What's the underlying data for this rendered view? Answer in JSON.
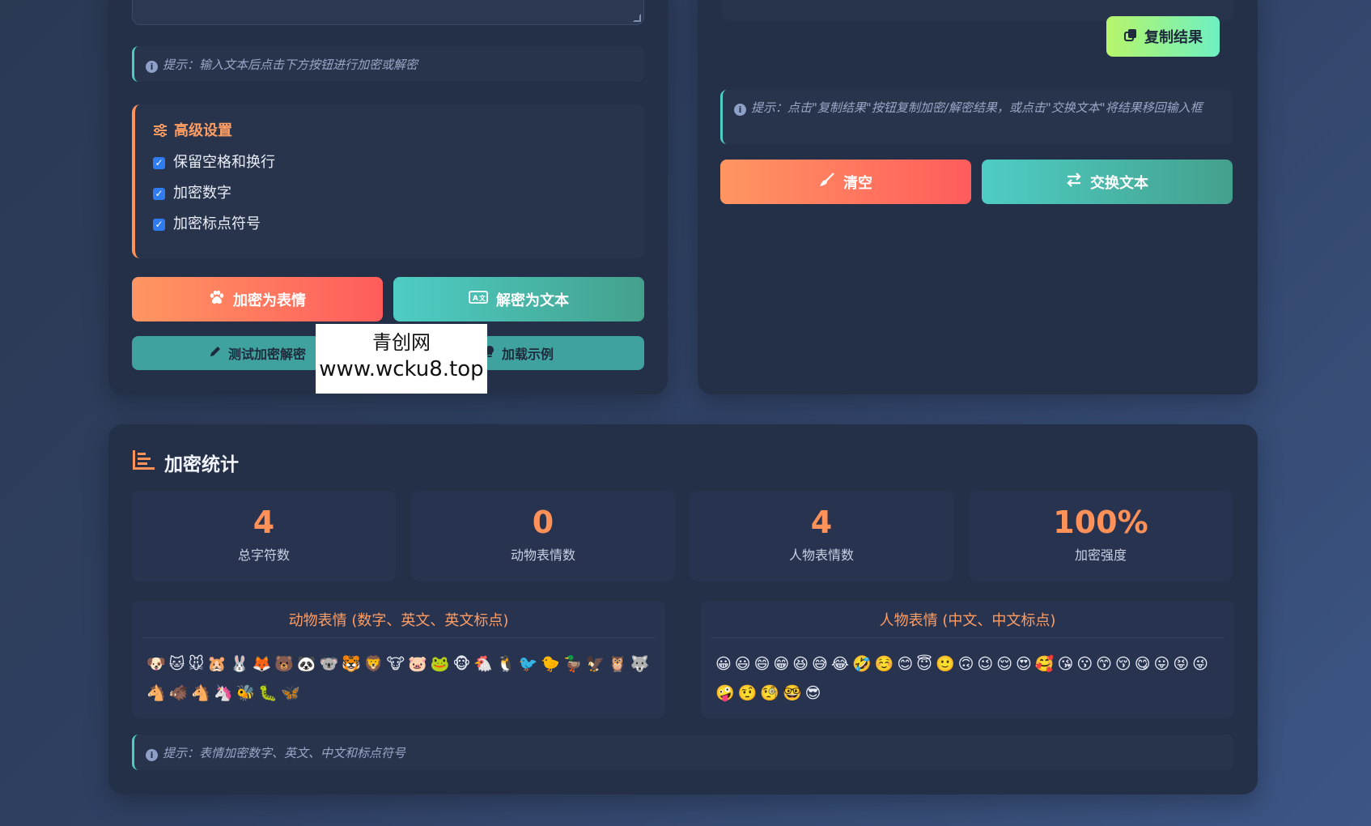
{
  "left_panel": {
    "input_hint": "提示：输入文本后点击下方按钮进行加密或解密",
    "advanced": {
      "title": "高级设置",
      "options": [
        {
          "label": "保留空格和换行",
          "checked": true
        },
        {
          "label": "加密数字",
          "checked": true
        },
        {
          "label": "加密标点符号",
          "checked": true
        }
      ]
    },
    "encrypt_button": "加密为表情",
    "decrypt_button": "解密为文本",
    "test_button": "测试加密解密",
    "example_button": "加载示例"
  },
  "right_panel": {
    "copy_button": "复制结果",
    "hint": "提示：点击\"复制结果\"按钮复制加密/解密结果，或点击\"交换文本\"将结果移回输入框",
    "clear_button": "清空",
    "swap_button": "交换文本"
  },
  "watermark": {
    "line1": "青创网",
    "line2": "www.wcku8.top"
  },
  "stats": {
    "title": "加密统计",
    "cards": [
      {
        "value": "4",
        "label": "总字符数"
      },
      {
        "value": "0",
        "label": "动物表情数"
      },
      {
        "value": "4",
        "label": "人物表情数"
      },
      {
        "value": "100%",
        "label": "加密强度"
      }
    ],
    "animal": {
      "title": "动物表情 (数字、英文、英文标点)",
      "emojis": "🐶🐱🐭🐹🐰🦊🐻🐼🐨🐯🦁🐮🐷🐸🐵🐔🐧🐦🐤🦆🦅🦉🐺🐴🐗🐴🦄🐝🐛🦋"
    },
    "people": {
      "title": "人物表情 (中文、中文标点)",
      "emojis": "😀😃😄😁😆😅😂🤣☺️😊😇🙂🙃😉😌😍🥰😘😗😙😚😋😛😝😜🤪🤨🧐🤓😎"
    },
    "hint": "提示：表情加密数字、英文、中文和标点符号"
  },
  "colors": {
    "accent_orange": "#ff9159",
    "accent_teal": "#4ecdc4",
    "panel_bg": "#242f48"
  }
}
